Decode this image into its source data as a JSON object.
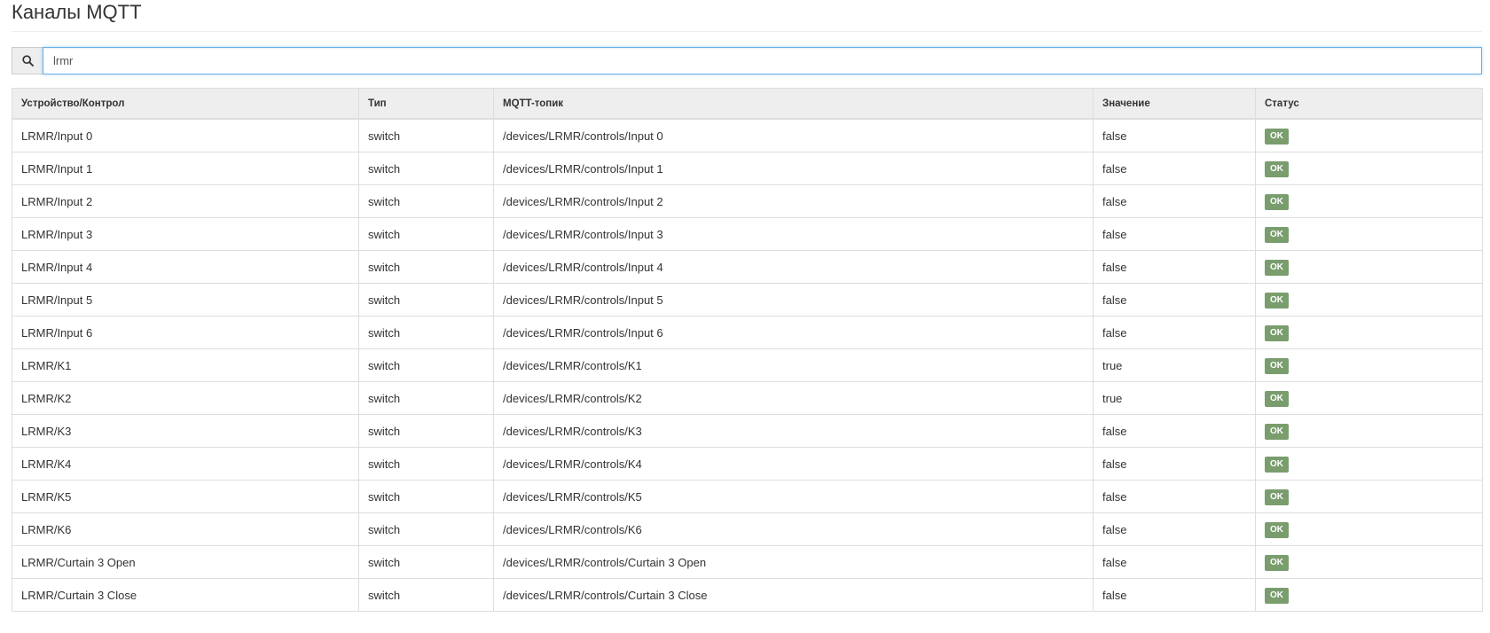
{
  "page": {
    "title": "Каналы MQTT"
  },
  "search": {
    "value": "lrmr",
    "placeholder": ""
  },
  "table": {
    "columns": [
      "Устройство/Контрол",
      "Тип",
      "MQTT-топик",
      "Значение",
      "Статус"
    ],
    "rows": [
      {
        "device": "LRMR/Input 0",
        "type": "switch",
        "topic": "/devices/LRMR/controls/Input 0",
        "value": "false",
        "status": "OK"
      },
      {
        "device": "LRMR/Input 1",
        "type": "switch",
        "topic": "/devices/LRMR/controls/Input 1",
        "value": "false",
        "status": "OK"
      },
      {
        "device": "LRMR/Input 2",
        "type": "switch",
        "topic": "/devices/LRMR/controls/Input 2",
        "value": "false",
        "status": "OK"
      },
      {
        "device": "LRMR/Input 3",
        "type": "switch",
        "topic": "/devices/LRMR/controls/Input 3",
        "value": "false",
        "status": "OK"
      },
      {
        "device": "LRMR/Input 4",
        "type": "switch",
        "topic": "/devices/LRMR/controls/Input 4",
        "value": "false",
        "status": "OK"
      },
      {
        "device": "LRMR/Input 5",
        "type": "switch",
        "topic": "/devices/LRMR/controls/Input 5",
        "value": "false",
        "status": "OK"
      },
      {
        "device": "LRMR/Input 6",
        "type": "switch",
        "topic": "/devices/LRMR/controls/Input 6",
        "value": "false",
        "status": "OK"
      },
      {
        "device": "LRMR/K1",
        "type": "switch",
        "topic": "/devices/LRMR/controls/K1",
        "value": "true",
        "status": "OK"
      },
      {
        "device": "LRMR/K2",
        "type": "switch",
        "topic": "/devices/LRMR/controls/K2",
        "value": "true",
        "status": "OK"
      },
      {
        "device": "LRMR/K3",
        "type": "switch",
        "topic": "/devices/LRMR/controls/K3",
        "value": "false",
        "status": "OK"
      },
      {
        "device": "LRMR/K4",
        "type": "switch",
        "topic": "/devices/LRMR/controls/K4",
        "value": "false",
        "status": "OK"
      },
      {
        "device": "LRMR/K5",
        "type": "switch",
        "topic": "/devices/LRMR/controls/K5",
        "value": "false",
        "status": "OK"
      },
      {
        "device": "LRMR/K6",
        "type": "switch",
        "topic": "/devices/LRMR/controls/K6",
        "value": "false",
        "status": "OK"
      },
      {
        "device": "LRMR/Curtain 3 Open",
        "type": "switch",
        "topic": "/devices/LRMR/controls/Curtain 3 Open",
        "value": "false",
        "status": "OK"
      },
      {
        "device": "LRMR/Curtain 3 Close",
        "type": "switch",
        "topic": "/devices/LRMR/controls/Curtain 3 Close",
        "value": "false",
        "status": "OK"
      }
    ]
  },
  "icons": {
    "search": "search-icon"
  },
  "colors": {
    "status_ok": "#7a9d6e",
    "header_bg": "#eeeeee",
    "input_focus_border": "#66afe9"
  }
}
